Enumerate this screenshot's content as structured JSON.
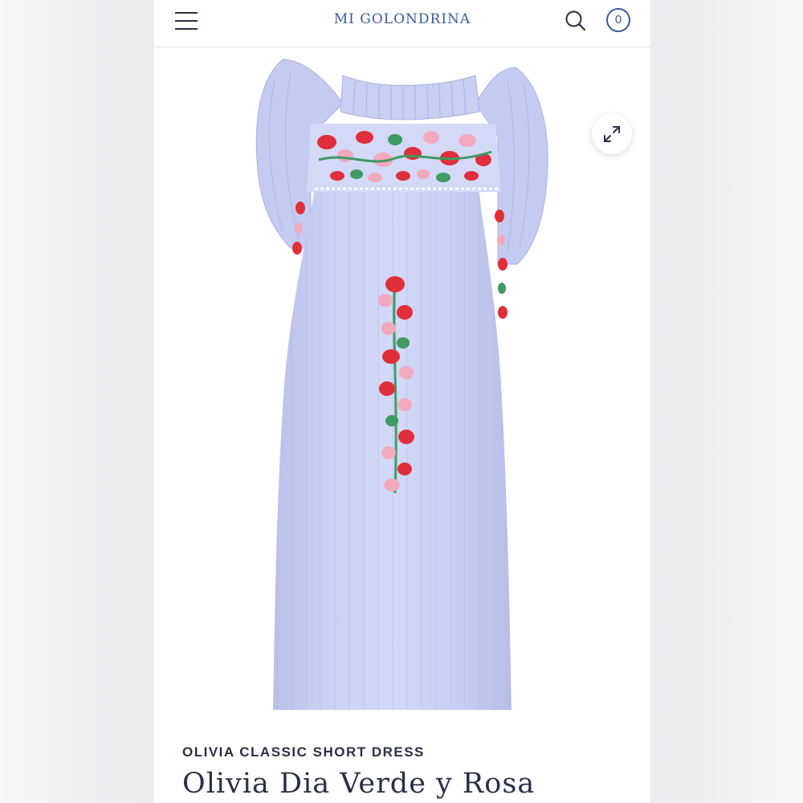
{
  "header": {
    "brand": "MI GOLONDRINA",
    "cart_count": "0"
  },
  "icons": {
    "menu": "hamburger-menu-icon",
    "search": "search-icon",
    "expand": "expand-icon"
  },
  "product": {
    "collection": "OLIVIA CLASSIC SHORT DRESS",
    "name": "Olivia Dia Verde y Rosa",
    "dress_color": "#c9d0f3",
    "embroidery_colors": [
      "#e02f3a",
      "#f2a9be",
      "#3f9a63",
      "#ffffff"
    ]
  },
  "colors": {
    "brand": "#3b5a9a",
    "text": "#2a2f45"
  }
}
